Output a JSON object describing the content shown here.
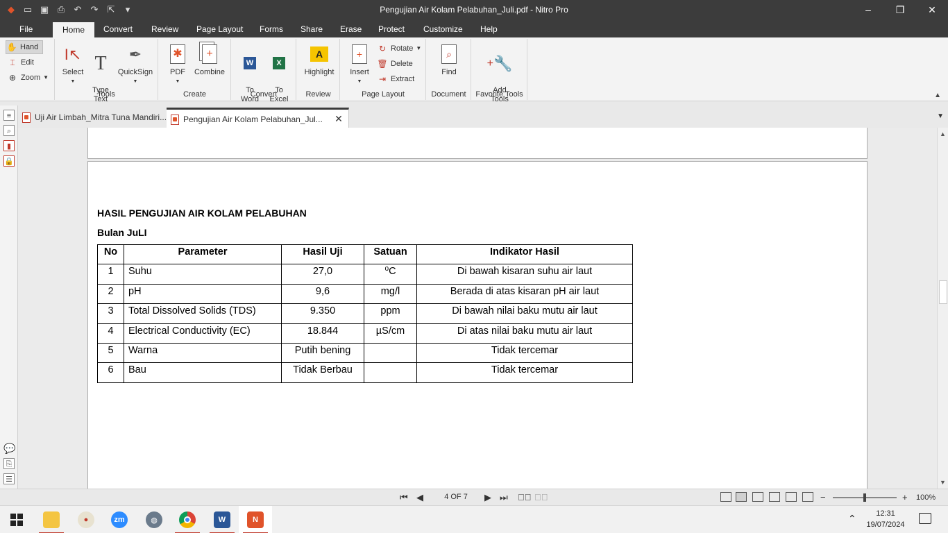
{
  "window": {
    "title": "Pengujian Air Kolam Pelabuhan_Juli.pdf - Nitro Pro"
  },
  "menu": {
    "tabs": [
      "File",
      "Home",
      "Convert",
      "Review",
      "Page Layout",
      "Forms",
      "Share",
      "Erase",
      "Protect",
      "Customize",
      "Help"
    ],
    "active": "Home"
  },
  "ribbon": {
    "nav": {
      "hand": "Hand",
      "edit": "Edit",
      "zoom": "Zoom"
    },
    "tools": {
      "select": "Select",
      "type_text": "Type\nText",
      "quicksign": "QuickSign",
      "label": "Tools"
    },
    "create": {
      "pdf": "PDF",
      "combine": "Combine",
      "label": "Create"
    },
    "convert": {
      "to_word": "To\nWord",
      "to_excel": "To\nExcel",
      "label": "Convert"
    },
    "review": {
      "highlight": "Highlight",
      "label": "Review"
    },
    "page_layout": {
      "insert": "Insert",
      "rotate": "Rotate",
      "delete": "Delete",
      "extract": "Extract",
      "label": "Page Layout"
    },
    "document": {
      "find": "Find",
      "label": "Document"
    },
    "favorite": {
      "add_tools": "Add\nTools",
      "label": "Favorite Tools"
    }
  },
  "doc_tabs": [
    {
      "label": "Uji Air Limbah_Mitra Tuna Mandiri...",
      "active": false
    },
    {
      "label": "Pengujian Air Kolam Pelabuhan_Jul...",
      "active": true
    }
  ],
  "document": {
    "title": "HASIL PENGUJIAN AIR KOLAM PELABUHAN",
    "subtitle": "Bulan JuLI",
    "table": {
      "headers": [
        "No",
        "Parameter",
        "Hasil Uji",
        "Satuan",
        "Indikator Hasil"
      ],
      "rows": [
        [
          "1",
          "Suhu",
          "27,0",
          "⁰C",
          "Di bawah kisaran suhu air laut"
        ],
        [
          "2",
          "pH",
          "9,6",
          "mg/l",
          "Berada di atas kisaran pH air laut"
        ],
        [
          "3",
          "Total Dissolved Solids (TDS)",
          "9.350",
          "ppm",
          "Di bawah nilai baku mutu air laut"
        ],
        [
          "4",
          "Electrical Conductivity (EC)",
          "18.844",
          "µS/cm",
          "Di atas nilai baku mutu air laut"
        ],
        [
          "5",
          "Warna",
          "Putih bening",
          "",
          "Tidak tercemar"
        ],
        [
          "6",
          "Bau",
          "Tidak Berbau",
          "",
          "Tidak tercemar"
        ]
      ]
    }
  },
  "status": {
    "page_indicator": "4 OF 7",
    "zoom": "100%"
  },
  "taskbar": {
    "time": "12:31",
    "date": "19/07/2024",
    "zoom_label": "zm"
  },
  "colors": {
    "accent": "#c0392b",
    "titlebar": "#3c3c3c",
    "ribbon": "#f3f3f3"
  }
}
